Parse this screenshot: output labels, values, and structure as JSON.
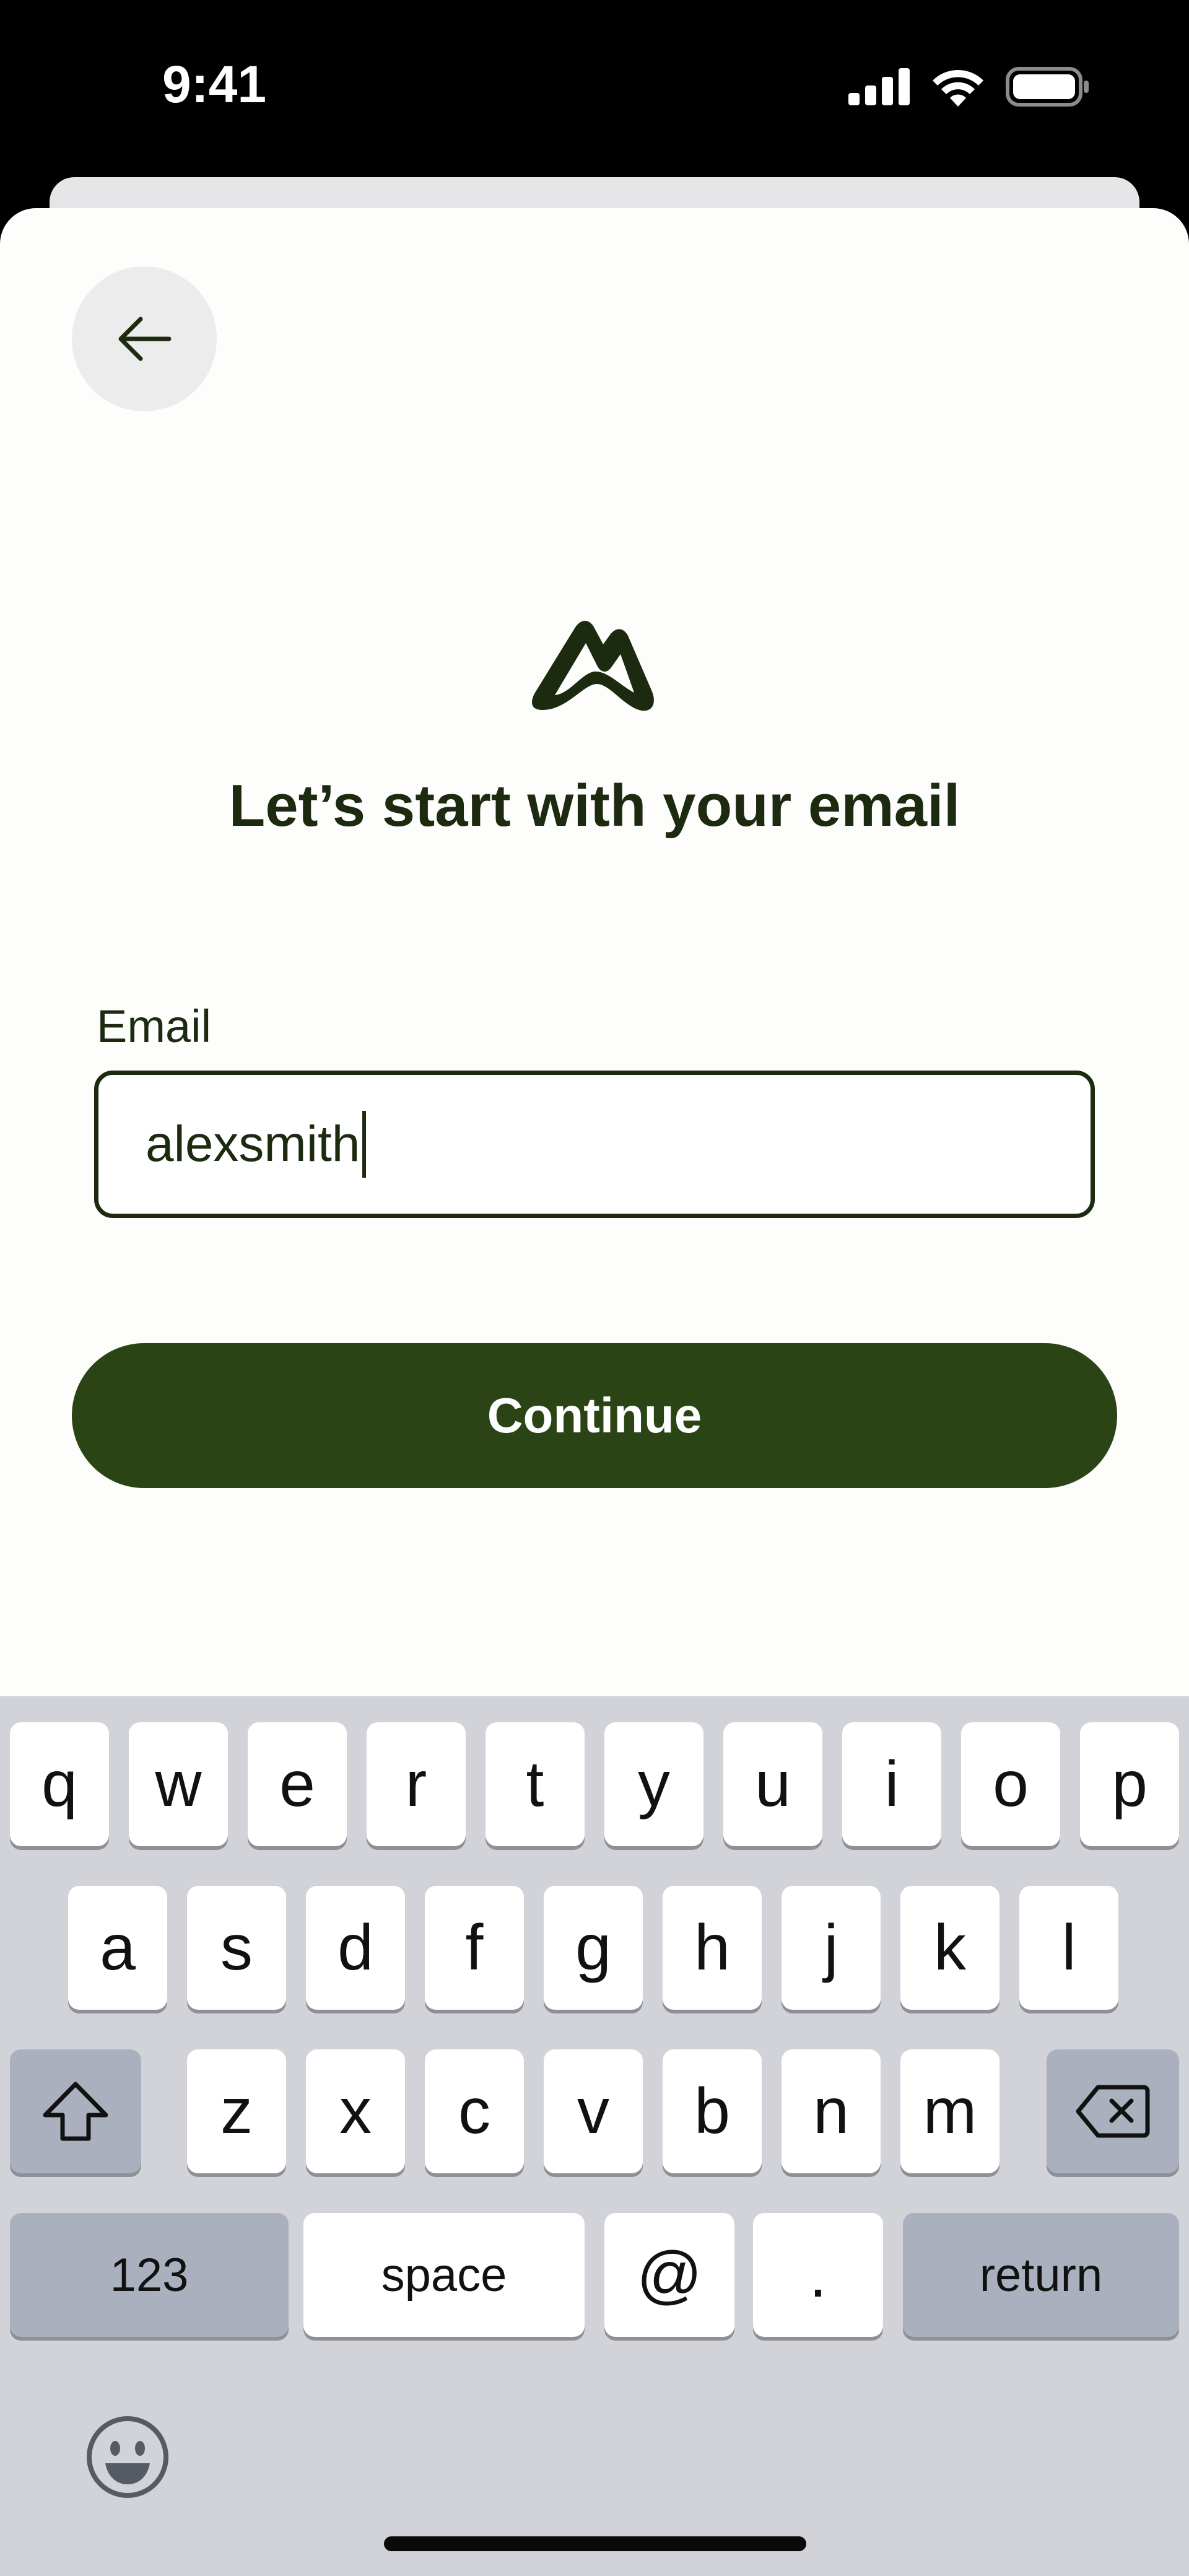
{
  "status_bar": {
    "time": "9:41"
  },
  "header": {
    "back_icon": "arrow-left-icon"
  },
  "logo": {
    "icon": "mountain-logo-icon"
  },
  "headline": "Let’s start with your email",
  "form": {
    "email_label": "Email",
    "email_value": "alexsmith",
    "continue_label": "Continue"
  },
  "colors": {
    "brand_green": "#2b4415",
    "text_dark": "#1c2a10",
    "keyboard_bg": "#d2d3d8"
  },
  "keyboard": {
    "row1": [
      "q",
      "w",
      "e",
      "r",
      "t",
      "y",
      "u",
      "i",
      "o",
      "p"
    ],
    "row2": [
      "a",
      "s",
      "d",
      "f",
      "g",
      "h",
      "j",
      "k",
      "l"
    ],
    "row3": [
      "z",
      "x",
      "c",
      "v",
      "b",
      "n",
      "m"
    ],
    "numbers_label": "123",
    "space_label": "space",
    "at_label": "@",
    "dot_label": ".",
    "return_label": "return",
    "shift_icon": "shift-icon",
    "delete_icon": "delete-icon",
    "emoji_icon": "emoji-icon"
  }
}
